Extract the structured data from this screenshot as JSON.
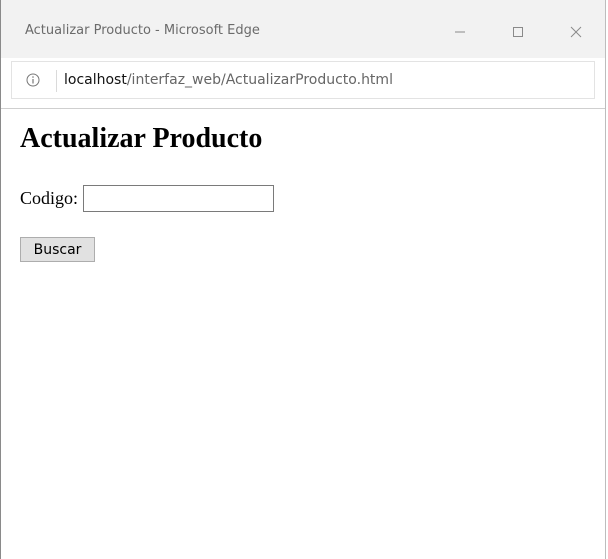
{
  "window": {
    "title": "Actualizar Producto - Microsoft Edge"
  },
  "address_bar": {
    "url_host": "localhost",
    "url_path": "/interfaz_web/ActualizarProducto.html"
  },
  "page": {
    "heading": "Actualizar Producto",
    "codigo_label": "Codigo:",
    "codigo_value": "",
    "buscar_label": "Buscar"
  },
  "icons": {
    "info": "info-icon",
    "minimize": "minimize-icon",
    "maximize": "maximize-icon",
    "close": "close-icon"
  }
}
